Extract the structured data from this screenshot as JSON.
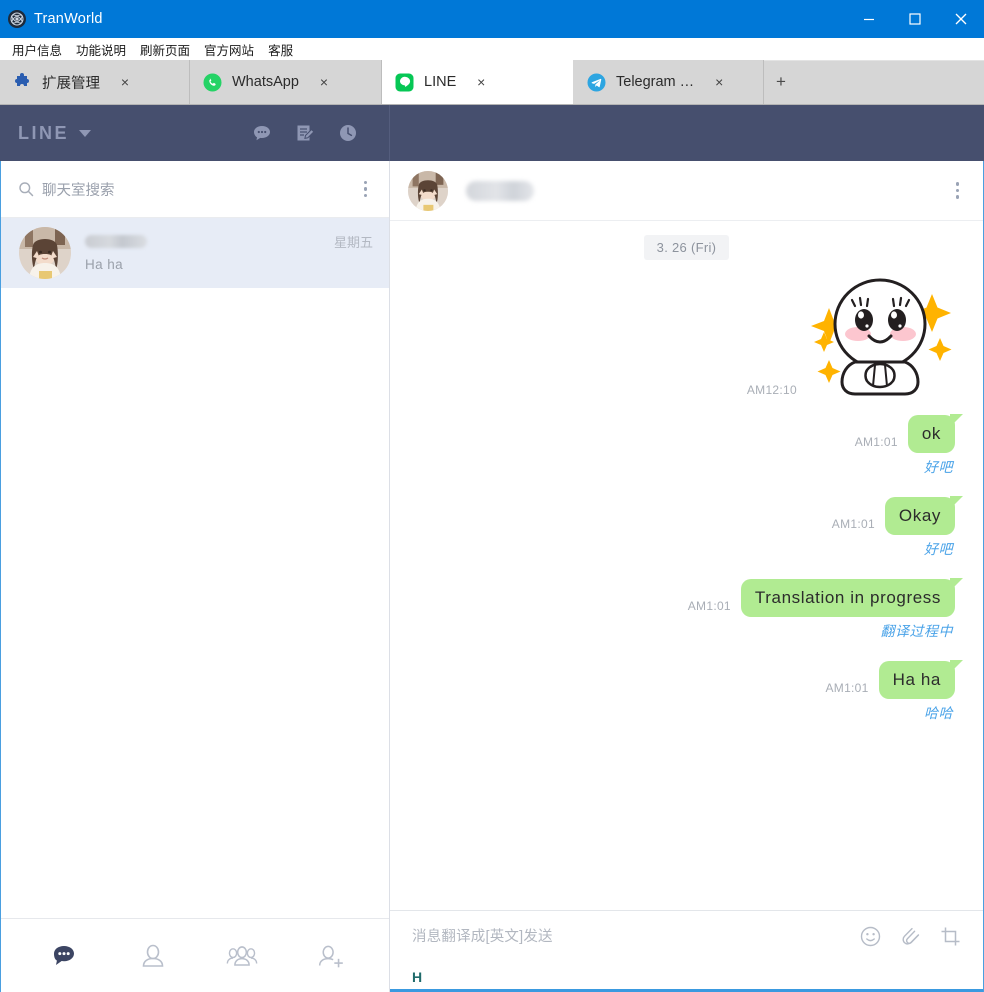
{
  "window": {
    "title": "TranWorld",
    "app_icon": "tranworld-logo-icon",
    "minimize_label": "—",
    "maximize_label": "☐",
    "close_label": "✕",
    "titlebar_color": "#0078d7"
  },
  "menubar": {
    "items": [
      {
        "label": "用户信息"
      },
      {
        "label": "功能说明"
      },
      {
        "label": "刷新页面"
      },
      {
        "label": "官方网站"
      },
      {
        "label": "客服"
      }
    ]
  },
  "tabs": {
    "items": [
      {
        "label": "扩展管理",
        "icon": "puzzle-piece-icon",
        "active": false,
        "close_label": "×"
      },
      {
        "label": "WhatsApp",
        "icon": "whatsapp-icon",
        "active": false,
        "close_label": "×"
      },
      {
        "label": "LINE",
        "icon": "line-icon",
        "active": true,
        "close_label": "×"
      },
      {
        "label": "Telegram …",
        "icon": "telegram-icon",
        "active": false,
        "close_label": "×"
      }
    ],
    "new_tab_label": "+"
  },
  "line_header": {
    "logo_text": "LINE",
    "dropdown_icon": "chevron-down-icon",
    "icons": [
      {
        "name": "chat-bubble-icon"
      },
      {
        "name": "note-edit-icon"
      },
      {
        "name": "clock-history-icon"
      }
    ],
    "background_color": "#464f6e"
  },
  "sidebar": {
    "search": {
      "placeholder": "聊天室搜索",
      "icon": "search-icon"
    },
    "more_menu_icon": "kebab-menu-icon",
    "chats": [
      {
        "name_redacted": true,
        "preview": "Ha  ha",
        "time": "星期五",
        "selected": true,
        "avatar": "contact-photo-avatar"
      }
    ],
    "bottom_nav": [
      {
        "name": "nav-chats",
        "icon": "chat-bubble-filled-icon",
        "active": true
      },
      {
        "name": "nav-friends",
        "icon": "person-icon",
        "active": false
      },
      {
        "name": "nav-groups",
        "icon": "people-group-icon",
        "active": false
      },
      {
        "name": "nav-add-friend",
        "icon": "person-add-icon",
        "active": false
      }
    ]
  },
  "conversation": {
    "header": {
      "avatar": "contact-photo-avatar",
      "name_redacted": true,
      "more_menu_icon": "kebab-menu-icon"
    },
    "date_divider": "3. 26 (Fri)",
    "messages": [
      {
        "type": "sticker",
        "sticker": "sparkle-praying-blob-sticker",
        "time": "AM12:10",
        "outgoing": true
      },
      {
        "type": "text",
        "text": "ok",
        "time": "AM1:01",
        "translation": "好吧",
        "outgoing": true
      },
      {
        "type": "text",
        "text": "Okay",
        "time": "AM1:01",
        "translation": "好吧",
        "outgoing": true
      },
      {
        "type": "text",
        "text": "Translation in progress",
        "time": "AM1:01",
        "translation": "翻译过程中",
        "outgoing": true
      },
      {
        "type": "text",
        "text": "Ha ha",
        "time": "AM1:01",
        "translation": "哈哈",
        "outgoing": true
      }
    ],
    "bubble_color": "#b1eb92",
    "translation_color": "#4aa3e8"
  },
  "composer": {
    "placeholder": "消息翻译成[英文]发送",
    "typed_text": "H",
    "icons": [
      {
        "name": "emoji-smiley-icon"
      },
      {
        "name": "attachment-paperclip-icon"
      },
      {
        "name": "screenshot-crop-icon"
      }
    ]
  }
}
